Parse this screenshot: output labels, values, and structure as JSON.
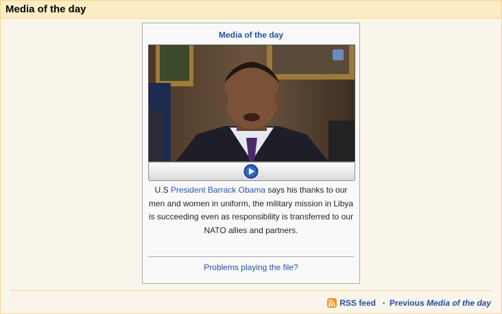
{
  "header": {
    "title": "Media of the day"
  },
  "media": {
    "title": "Media of the day",
    "caption_pre": "U.S ",
    "caption_link": "President Barrack Obama",
    "caption_post": " says his thanks to our men and women in uniform, the military mission in Libya is succeeding even as responsibility is transferred to our NATO allies and partners.",
    "problems_link": "Problems playing the file?",
    "play_icon": "play-icon"
  },
  "footer": {
    "rss_label": "RSS feed",
    "separator": "·",
    "previous_label": "Previous ",
    "previous_italic": "Media of the day"
  },
  "colors": {
    "header_bg": "#fbedc4",
    "border": "#f2d58f",
    "link": "#1f4fa3",
    "rss": "#f7941d"
  }
}
